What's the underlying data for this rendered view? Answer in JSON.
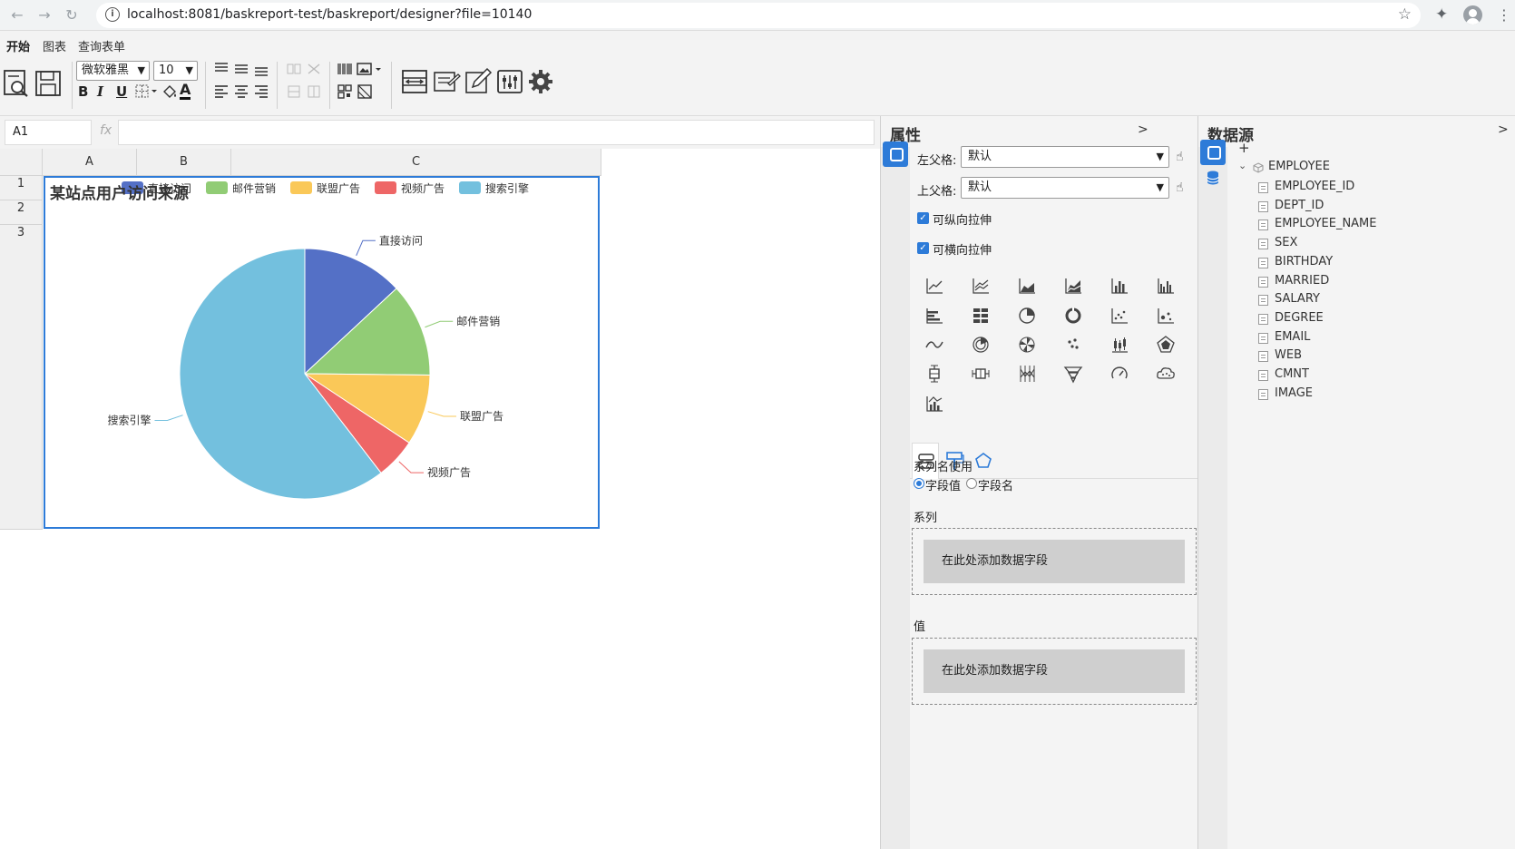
{
  "browser": {
    "url": "localhost:8081/baskreport-test/baskreport/designer?file=10140",
    "back_icon": "arrow-left",
    "forward_icon": "arrow-right",
    "reload_icon": "reload"
  },
  "menu": {
    "tabs": [
      {
        "label": "开始",
        "active": true
      },
      {
        "label": "图表",
        "active": false
      },
      {
        "label": "查询表单",
        "active": false
      }
    ]
  },
  "toolbar": {
    "font_family": "微软雅黑",
    "font_size": "10",
    "bold": "B",
    "italic": "I",
    "underline": "U",
    "text_color": "A"
  },
  "formula": {
    "cell_ref": "A1",
    "fx": "fx",
    "value": ""
  },
  "sheet": {
    "columns": [
      "A",
      "B",
      "C"
    ],
    "rows": [
      "1",
      "2",
      "3"
    ]
  },
  "chart_data": {
    "type": "pie",
    "title": "某站点用户访问来源",
    "categories": [
      "直接访问",
      "邮件营销",
      "联盟广告",
      "视频广告",
      "搜索引擎"
    ],
    "values": [
      335,
      310,
      234,
      135,
      1548
    ],
    "colors": [
      "#5470c6",
      "#91cc75",
      "#fac858",
      "#ee6666",
      "#73c0de"
    ],
    "legend_position": "top"
  },
  "properties": {
    "title": "属性",
    "collapse_label": ">",
    "left_parent_label": "左父格:",
    "left_parent_value": "默认",
    "top_parent_label": "上父格:",
    "top_parent_value": "默认",
    "vertical_stretch_label": "可纵向拉伸",
    "horizontal_stretch_label": "可横向拉伸",
    "series_name_label": "系列名使用",
    "radio_field_value": "字段值",
    "radio_field_name": "字段名",
    "series_label": "系列",
    "series_drop": "在此处添加数据字段",
    "value_label": "值",
    "value_drop": "在此处添加数据字段"
  },
  "datasource": {
    "title": "数据源",
    "collapse_label": ">",
    "add_label": "+",
    "table": "EMPLOYEE",
    "fields": [
      "EMPLOYEE_ID",
      "DEPT_ID",
      "EMPLOYEE_NAME",
      "SEX",
      "BIRTHDAY",
      "MARRIED",
      "SALARY",
      "DEGREE",
      "EMAIL",
      "WEB",
      "CMNT",
      "IMAGE"
    ]
  }
}
